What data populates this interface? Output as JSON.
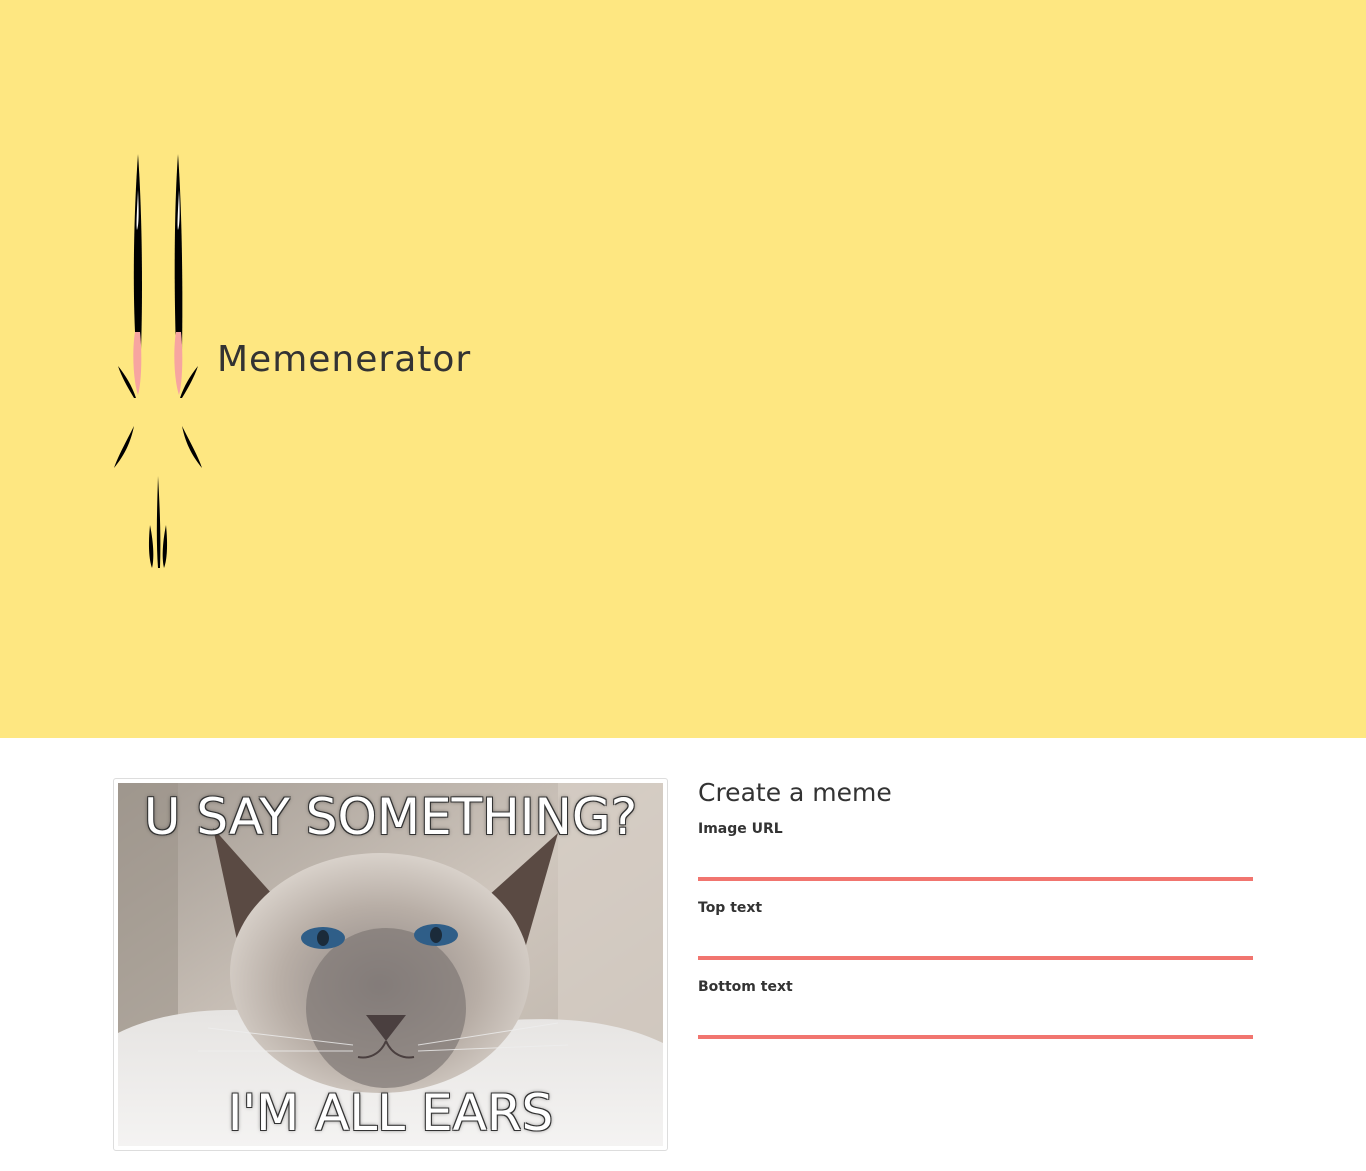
{
  "header": {
    "brand": "Memenerator",
    "logo_icon": "cat-face-icon",
    "background_color": "#fee781"
  },
  "meme": {
    "top_text": "U SAY SOMETHING?",
    "bottom_text": "I'M ALL EARS",
    "image_icon": "siamese-cat-photo"
  },
  "form": {
    "title": "Create a meme",
    "fields": [
      {
        "label": "Image URL",
        "value": ""
      },
      {
        "label": "Top text",
        "value": ""
      },
      {
        "label": "Bottom text",
        "value": ""
      }
    ],
    "accent_color": "#f1756f"
  }
}
